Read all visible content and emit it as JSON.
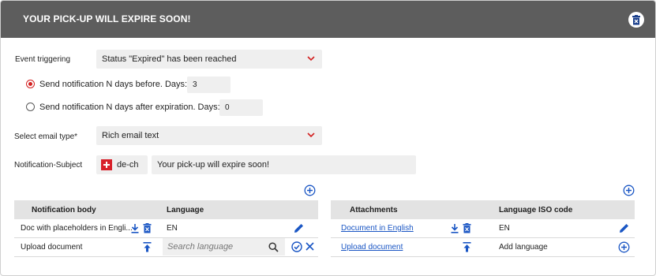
{
  "dialog": {
    "title": "YOUR PICK-UP WILL EXPIRE SOON!"
  },
  "form": {
    "event_triggering_label": "Event triggering",
    "event_triggering_value": "Status \"Expired\" has been reached",
    "radio_before_label": "Send notification N days before. Days:",
    "radio_before_days": "3",
    "radio_after_label": "Send notification N days after expiration. Days:",
    "radio_after_days": "0",
    "email_type_label": "Select email type*",
    "email_type_value": "Rich email text",
    "subject_label": "Notification-Subject",
    "subject_language": "de-ch",
    "subject_value": "Your pick-up will expire soon!"
  },
  "body_table": {
    "headers": [
      "Notification body",
      "Language"
    ],
    "rows": [
      {
        "name": "Doc with placeholders in Engli...",
        "language": "EN"
      },
      {
        "name": "Upload document",
        "language": ""
      }
    ],
    "search_placeholder": "Search language"
  },
  "attachments_table": {
    "headers": [
      "Attachments",
      "Language ISO code"
    ],
    "rows": [
      {
        "name": "Document in English",
        "language": "EN"
      },
      {
        "name": "Upload document",
        "language": "Add language"
      }
    ]
  },
  "colors": {
    "header_bg": "#5d5d5d",
    "accent_blue": "#1a56c4",
    "accent_red": "#d32020"
  }
}
